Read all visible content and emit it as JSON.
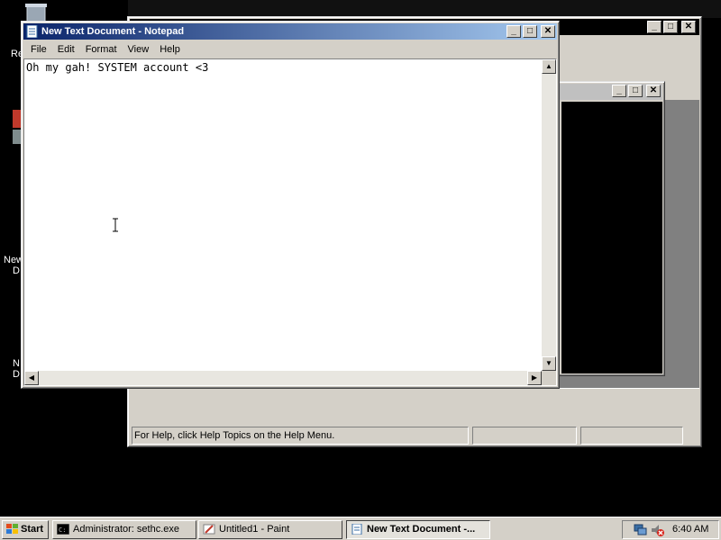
{
  "desktop": {
    "icon_labels": [
      "Re",
      "New",
      "D",
      "N",
      "D"
    ]
  },
  "paint": {
    "status_text": "For Help, click Help Topics on the Help Menu."
  },
  "notepad": {
    "title": "New Text Document - Notepad",
    "menu": [
      "File",
      "Edit",
      "Format",
      "View",
      "Help"
    ],
    "content": "Oh my gah! SYSTEM account <3"
  },
  "window_controls": {
    "minimize": "_",
    "maximize": "□",
    "close": "✕"
  },
  "taskbar": {
    "start_label": "Start",
    "items": [
      {
        "label": "Administrator: sethc.exe",
        "icon": "cmd-icon"
      },
      {
        "label": "Untitled1 - Paint",
        "icon": "paint-icon"
      },
      {
        "label": "New Text Document -...",
        "icon": "notepad-icon"
      }
    ],
    "clock": "6:40 AM"
  },
  "colors": {
    "title_active": "#0a246a",
    "title_active_end": "#a6caf0",
    "chrome": "#d4d0c8",
    "desktop": "#000000"
  }
}
